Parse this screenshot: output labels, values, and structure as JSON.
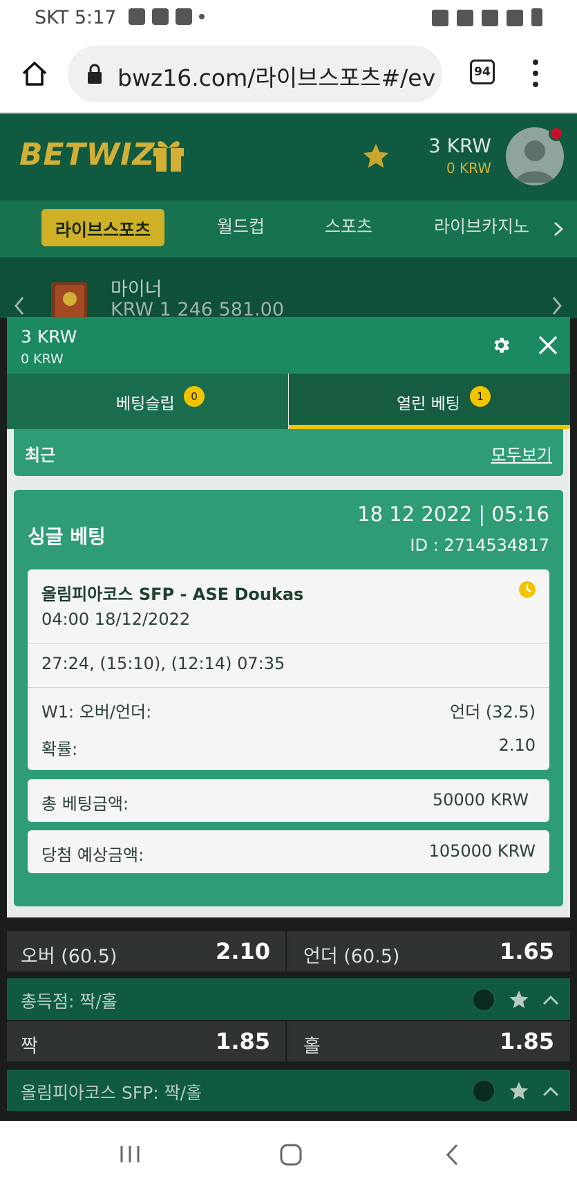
{
  "status_bar": {
    "carrier_time": "SKT 5:17"
  },
  "browser": {
    "url": "bwz16.com/라이브스포츠#/ev",
    "tab_count": "94"
  },
  "site": {
    "logo": "BETWIZ",
    "balance_main": "3 KRW",
    "balance_bonus": "0 KRW",
    "nav": [
      "라이브스포츠",
      "월드컵",
      "스포츠",
      "라이브카지노"
    ],
    "bonus_title": "마이너",
    "bonus_amount": "KRW 1 246 581.00"
  },
  "slip": {
    "balance_main": "3 KRW",
    "balance_bonus": "0 KRW",
    "tabs": [
      {
        "label": "베팅슬립",
        "badge": "0"
      },
      {
        "label": "열린 베팅",
        "badge": "1"
      }
    ],
    "recent_label": "최근",
    "view_all": "모두보기",
    "bet": {
      "type": "싱글 베팅",
      "datetime": "18 12 2022 | 05:16",
      "id": "ID :  2714534817",
      "event": "올림피아코스 SFP - ASE Doukas",
      "event_time": "04:00   18/12/2022",
      "score": "27:24, (15:10), (12:14) 07:35",
      "market_label": "W1: 오버/언더:",
      "market_value": "언더 (32.5)",
      "odds_label": "확률:",
      "odds_value": "2.10",
      "stake_label": "총 베팅금액:",
      "stake_value": "50000 KRW",
      "payout_label": "당첨 예상금액:",
      "payout_value": "105000 KRW"
    }
  },
  "background_markets": {
    "row1": {
      "left_label": "오버 (60.5)",
      "left_odds": "2.10",
      "right_label": "언더 (60.5)",
      "right_odds": "1.65"
    },
    "header2": "총득점: 짝/홀",
    "row2": {
      "left_label": "짝",
      "left_odds": "1.85",
      "right_label": "홀",
      "right_odds": "1.85"
    },
    "header3": "올림피아코스 SFP: 짝/홀"
  },
  "colors": {
    "brand_green": "#0f5a40",
    "accent_gold": "#d2b038",
    "slip_green": "#2e9c75",
    "badge_yellow": "#f2c400"
  }
}
